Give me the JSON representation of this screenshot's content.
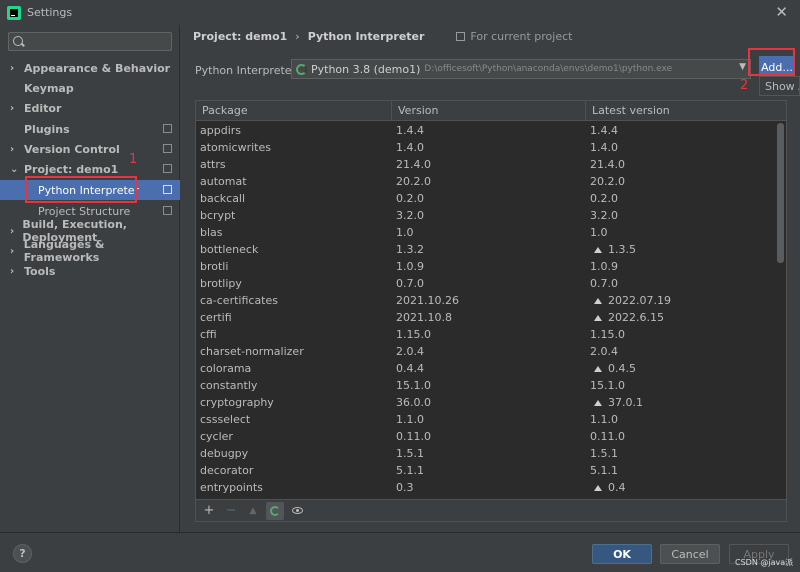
{
  "window": {
    "title": "Settings",
    "close_icon": "close-icon"
  },
  "sidebar": {
    "search_placeholder": "",
    "items": [
      {
        "label": "Appearance & Behavior",
        "chev": "›"
      },
      {
        "label": "Keymap",
        "chev": ""
      },
      {
        "label": "Editor",
        "chev": "›"
      },
      {
        "label": "Plugins",
        "chev": ""
      },
      {
        "label": "Version Control",
        "chev": "›"
      },
      {
        "label": "Project: demo1",
        "chev": "⌄"
      },
      {
        "label": "Python Interpreter",
        "chev": ""
      },
      {
        "label": "Project Structure",
        "chev": ""
      },
      {
        "label": "Build, Execution, Deployment",
        "chev": "›"
      },
      {
        "label": "Languages & Frameworks",
        "chev": "›"
      },
      {
        "label": "Tools",
        "chev": "›"
      }
    ]
  },
  "annotations": {
    "marker_1": "1",
    "marker_2": "2"
  },
  "breadcrumb": {
    "project": "Project: demo1",
    "separator": "›",
    "page": "Python Interpreter",
    "note": "For current project"
  },
  "interpreter": {
    "label": "Python Interpreter:",
    "name": "Python 3.8 (demo1)",
    "path": "D:\\officesoft\\Python\\anaconda\\envs\\demo1\\python.exe",
    "add_label": "Add...",
    "show_label": "Show All..."
  },
  "table": {
    "headers": [
      "Package",
      "Version",
      "Latest version"
    ],
    "rows": [
      {
        "package": "appdirs",
        "version": "1.4.4",
        "latest": "1.4.4",
        "upgrade": false
      },
      {
        "package": "atomicwrites",
        "version": "1.4.0",
        "latest": "1.4.0",
        "upgrade": false
      },
      {
        "package": "attrs",
        "version": "21.4.0",
        "latest": "21.4.0",
        "upgrade": false
      },
      {
        "package": "automat",
        "version": "20.2.0",
        "latest": "20.2.0",
        "upgrade": false
      },
      {
        "package": "backcall",
        "version": "0.2.0",
        "latest": "0.2.0",
        "upgrade": false
      },
      {
        "package": "bcrypt",
        "version": "3.2.0",
        "latest": "3.2.0",
        "upgrade": false
      },
      {
        "package": "blas",
        "version": "1.0",
        "latest": "1.0",
        "upgrade": false
      },
      {
        "package": "bottleneck",
        "version": "1.3.2",
        "latest": "1.3.5",
        "upgrade": true
      },
      {
        "package": "brotli",
        "version": "1.0.9",
        "latest": "1.0.9",
        "upgrade": false
      },
      {
        "package": "brotlipy",
        "version": "0.7.0",
        "latest": "0.7.0",
        "upgrade": false
      },
      {
        "package": "ca-certificates",
        "version": "2021.10.26",
        "latest": "2022.07.19",
        "upgrade": true
      },
      {
        "package": "certifi",
        "version": "2021.10.8",
        "latest": "2022.6.15",
        "upgrade": true
      },
      {
        "package": "cffi",
        "version": "1.15.0",
        "latest": "1.15.0",
        "upgrade": false
      },
      {
        "package": "charset-normalizer",
        "version": "2.0.4",
        "latest": "2.0.4",
        "upgrade": false
      },
      {
        "package": "colorama",
        "version": "0.4.4",
        "latest": "0.4.5",
        "upgrade": true
      },
      {
        "package": "constantly",
        "version": "15.1.0",
        "latest": "15.1.0",
        "upgrade": false
      },
      {
        "package": "cryptography",
        "version": "36.0.0",
        "latest": "37.0.1",
        "upgrade": true
      },
      {
        "package": "cssselect",
        "version": "1.1.0",
        "latest": "1.1.0",
        "upgrade": false
      },
      {
        "package": "cycler",
        "version": "0.11.0",
        "latest": "0.11.0",
        "upgrade": false
      },
      {
        "package": "debugpy",
        "version": "1.5.1",
        "latest": "1.5.1",
        "upgrade": false
      },
      {
        "package": "decorator",
        "version": "5.1.1",
        "latest": "5.1.1",
        "upgrade": false
      },
      {
        "package": "entrypoints",
        "version": "0.3",
        "latest": "0.4",
        "upgrade": true
      }
    ],
    "toolbar": {
      "add": "+",
      "remove": "−",
      "upgrade": "▲"
    }
  },
  "footer": {
    "help": "?",
    "ok": "OK",
    "cancel": "Cancel",
    "apply": "Apply",
    "watermark": "CSDN @java派"
  },
  "colors": {
    "accent": "#4b6eaf",
    "annotation": "#e8343f",
    "ok_button": "#365880"
  }
}
